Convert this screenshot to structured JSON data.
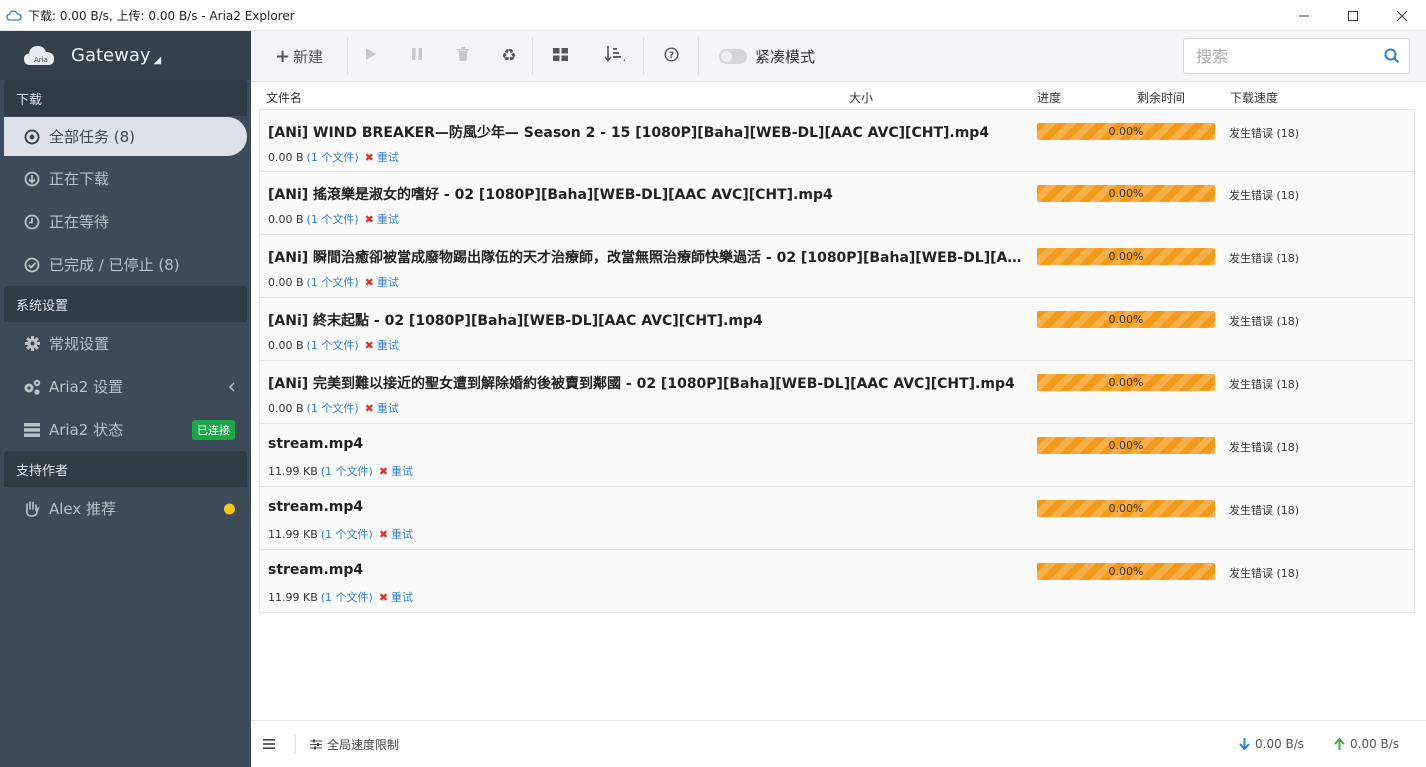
{
  "window": {
    "title": "下载: 0.00 B/s, 上传: 0.00 B/s - Aria2 Explorer"
  },
  "sidebar": {
    "header": "Gateway",
    "groups": [
      {
        "label": "下载"
      },
      {
        "label": "系统设置"
      },
      {
        "label": "支持作者"
      }
    ],
    "download_items": [
      {
        "label": "全部任务 (8)",
        "icon": "target-icon"
      },
      {
        "label": "正在下载",
        "icon": "download-circle-icon"
      },
      {
        "label": "正在等待",
        "icon": "clock-icon"
      },
      {
        "label": "已完成 / 已停止 (8)",
        "icon": "check-circle-icon"
      }
    ],
    "settings_items": [
      {
        "label": "常规设置",
        "icon": "gear-icon"
      },
      {
        "label": "Aria2 设置",
        "icon": "gears-icon"
      },
      {
        "label": "Aria2 状态",
        "icon": "server-icon",
        "badge": "已连接"
      }
    ],
    "support_items": [
      {
        "label": "Alex 推荐",
        "icon": "hand-icon"
      }
    ]
  },
  "toolbar": {
    "new_label": "新建",
    "compact_label": "紧凑模式",
    "search_placeholder": "搜索"
  },
  "table": {
    "headers": {
      "name": "文件名",
      "size": "大小",
      "progress": "进度",
      "remaining": "剩余时间",
      "speed": "下载速度"
    },
    "rows": [
      {
        "name": "[ANi] WIND BREAKER—防風少年— Season 2 - 15 [1080P][Baha][WEB-DL][AAC AVC][CHT].mp4",
        "size": "0.00 B",
        "files": "(1 个文件)",
        "retry": "重试",
        "progress": "0.00%",
        "status": "发生错误 (18)"
      },
      {
        "name": "[ANi] 搖滾樂是淑女的嗜好 - 02 [1080P][Baha][WEB-DL][AAC AVC][CHT].mp4",
        "size": "0.00 B",
        "files": "(1 个文件)",
        "retry": "重试",
        "progress": "0.00%",
        "status": "发生错误 (18)"
      },
      {
        "name": "[ANi] 瞬間治癒卻被當成廢物踢出隊伍的天才治療師，改當無照治療師快樂過活 - 02 [1080P][Baha][WEB-DL][AA...",
        "size": "0.00 B",
        "files": "(1 个文件)",
        "retry": "重试",
        "progress": "0.00%",
        "status": "发生错误 (18)"
      },
      {
        "name": "[ANi] 終末起點 - 02 [1080P][Baha][WEB-DL][AAC AVC][CHT].mp4",
        "size": "0.00 B",
        "files": "(1 个文件)",
        "retry": "重试",
        "progress": "0.00%",
        "status": "发生错误 (18)"
      },
      {
        "name": "[ANi] 完美到難以接近的聖女遭到解除婚約後被賣到鄰國 - 02 [1080P][Baha][WEB-DL][AAC AVC][CHT].mp4",
        "size": "0.00 B",
        "files": "(1 个文件)",
        "retry": "重试",
        "progress": "0.00%",
        "status": "发生错误 (18)"
      },
      {
        "name": "stream.mp4",
        "size": "11.99 KB",
        "files": "(1 个文件)",
        "retry": "重试",
        "progress": "0.00%",
        "status": "发生错误 (18)"
      },
      {
        "name": "stream.mp4",
        "size": "11.99 KB",
        "files": "(1 个文件)",
        "retry": "重试",
        "progress": "0.00%",
        "status": "发生错误 (18)"
      },
      {
        "name": "stream.mp4",
        "size": "11.99 KB",
        "files": "(1 个文件)",
        "retry": "重试",
        "progress": "0.00%",
        "status": "发生错误 (18)"
      }
    ]
  },
  "footer": {
    "speed_limit_label": "全局速度限制",
    "download_speed": "0.00 B/s",
    "upload_speed": "0.00 B/s"
  },
  "colors": {
    "sidebar_bg": "#3c4b57",
    "progress": "#f39a1a",
    "badge": "#1ba746",
    "accent": "#2f7fd0"
  }
}
